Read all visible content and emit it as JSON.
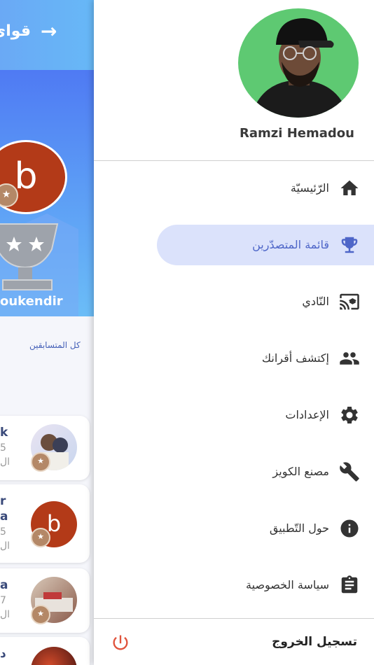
{
  "background": {
    "header_title": "قوائ",
    "back_arrow": "→",
    "hero_avatar_letter": "b",
    "hero_name": "oukendir",
    "all_competitors": "كل المتسابقين",
    "cards": [
      {
        "line1": "k",
        "line2": "5",
        "line3": "ال",
        "avatar": "photo-anime"
      },
      {
        "line1": "r",
        "line2": "a",
        "line3": "5",
        "line4": "ال",
        "avatar": "letter-b",
        "letter": "b"
      },
      {
        "line1": "a",
        "line2": "7",
        "line3": "ال",
        "avatar": "photo-desk"
      },
      {
        "line1": "د",
        "avatar": "photo-red"
      }
    ]
  },
  "drawer": {
    "user_name": "Ramzi Hemadou",
    "menu": [
      {
        "label": "الرّئيسيّة",
        "icon": "home-icon"
      },
      {
        "label": "قائمة المتصدّرين",
        "icon": "trophy-icon",
        "active": true
      },
      {
        "label": "النّادي",
        "icon": "cast-education-icon"
      },
      {
        "label": "إكتشف أقرانك",
        "icon": "people-icon"
      },
      {
        "label": "الإعدادات",
        "icon": "gear-icon"
      },
      {
        "label": "مصنع الكويز",
        "icon": "wrench-icon"
      },
      {
        "label": "حول التّطبيق",
        "icon": "info-icon"
      },
      {
        "label": "سياسة الخصوصية",
        "icon": "clipboard-icon"
      }
    ],
    "logout_label": "تسجيل الخروج",
    "logout_icon": "power-icon"
  },
  "colors": {
    "accent": "#4e66c8",
    "active_bg": "#dbe2fb",
    "profile_bg": "#5ec972",
    "logout_icon": "#e0533c"
  }
}
